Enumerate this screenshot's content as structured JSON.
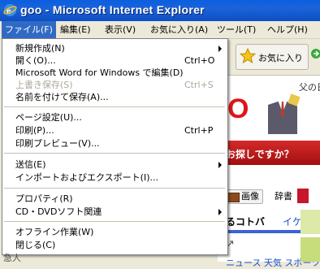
{
  "window": {
    "title": "goo - Microsoft Internet Explorer"
  },
  "menubar": {
    "items": [
      {
        "label": "ファイル(F)"
      },
      {
        "label": "編集(E)"
      },
      {
        "label": "表示(V)"
      },
      {
        "label": "お気に入り(A)"
      },
      {
        "label": "ツール(T)"
      },
      {
        "label": "ヘルプ(H)"
      }
    ]
  },
  "file_menu": {
    "items": [
      {
        "label": "新規作成(N)",
        "shortcut": "",
        "submenu": true,
        "disabled": false
      },
      {
        "label": "開く(O)...",
        "shortcut": "Ctrl+O",
        "submenu": false,
        "disabled": false
      },
      {
        "label": "Microsoft Word for Windows で編集(D)",
        "shortcut": "",
        "submenu": false,
        "disabled": false
      },
      {
        "label": "上書き保存(S)",
        "shortcut": "Ctrl+S",
        "submenu": false,
        "disabled": true
      },
      {
        "label": "名前を付けて保存(A)...",
        "shortcut": "",
        "submenu": false,
        "disabled": false
      },
      {
        "label": "ページ設定(U)...",
        "shortcut": "",
        "submenu": false,
        "disabled": false
      },
      {
        "label": "印刷(P)...",
        "shortcut": "Ctrl+P",
        "submenu": false,
        "disabled": false
      },
      {
        "label": "印刷プレビュー(V)...",
        "shortcut": "",
        "submenu": false,
        "disabled": false
      },
      {
        "label": "送信(E)",
        "shortcut": "",
        "submenu": true,
        "disabled": false
      },
      {
        "label": "インポートおよびエクスポート(I)...",
        "shortcut": "",
        "submenu": false,
        "disabled": false
      },
      {
        "label": "プロパティ(R)",
        "shortcut": "",
        "submenu": false,
        "disabled": false
      },
      {
        "label": "CD・DVDソフト関連",
        "shortcut": "",
        "submenu": true,
        "disabled": false
      },
      {
        "label": "オフライン作業(W)",
        "shortcut": "",
        "submenu": false,
        "disabled": false
      },
      {
        "label": "閉じる(C)",
        "shortcut": "",
        "submenu": false,
        "disabled": false
      }
    ]
  },
  "toolbar": {
    "favorites_label": "お気に入り"
  },
  "page": {
    "banner_letter": "O",
    "fathers_day": "父の日",
    "search_question": "お探しですか？",
    "tab_image": "画像",
    "tab_dict": "辞書",
    "word_kotoba": "るコトバ",
    "word_ikemen": "イケメン",
    "arrow": "↗",
    "bottom_links": "ニュース 天気 スポーツ",
    "bottom_item": "急人"
  }
}
